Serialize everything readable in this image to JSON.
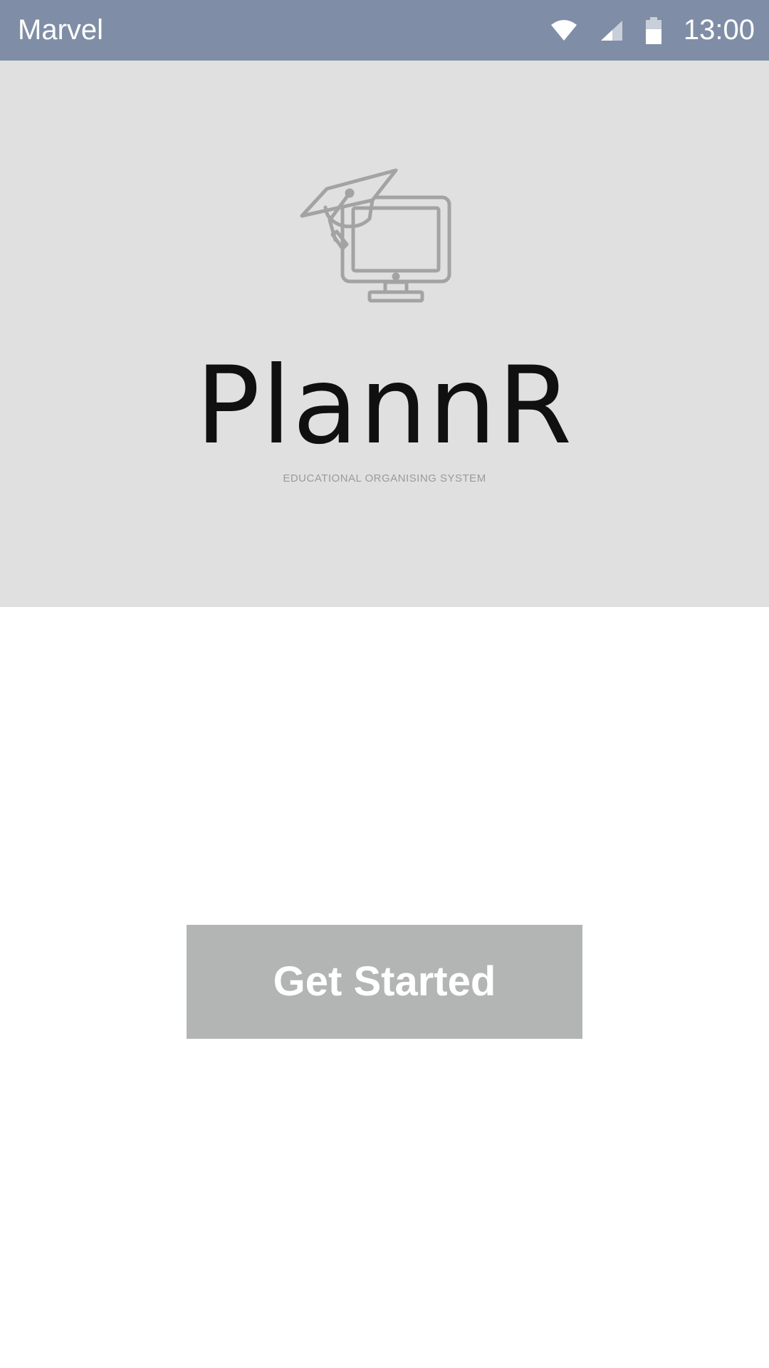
{
  "status_bar": {
    "app_name": "Marvel",
    "time": "13:00",
    "icons": [
      "wifi-icon",
      "cell-signal-icon",
      "battery-icon"
    ],
    "background": "#7f8ea6"
  },
  "hero": {
    "logo_icon": "graduation-cap-monitor-icon",
    "title": "PlannR",
    "subtitle": "EDUCATIONAL ORGANISING SYSTEM",
    "background": "#e0e0e0"
  },
  "actions": {
    "get_started_label": "Get Started",
    "button_color": "#b3b4b4"
  }
}
